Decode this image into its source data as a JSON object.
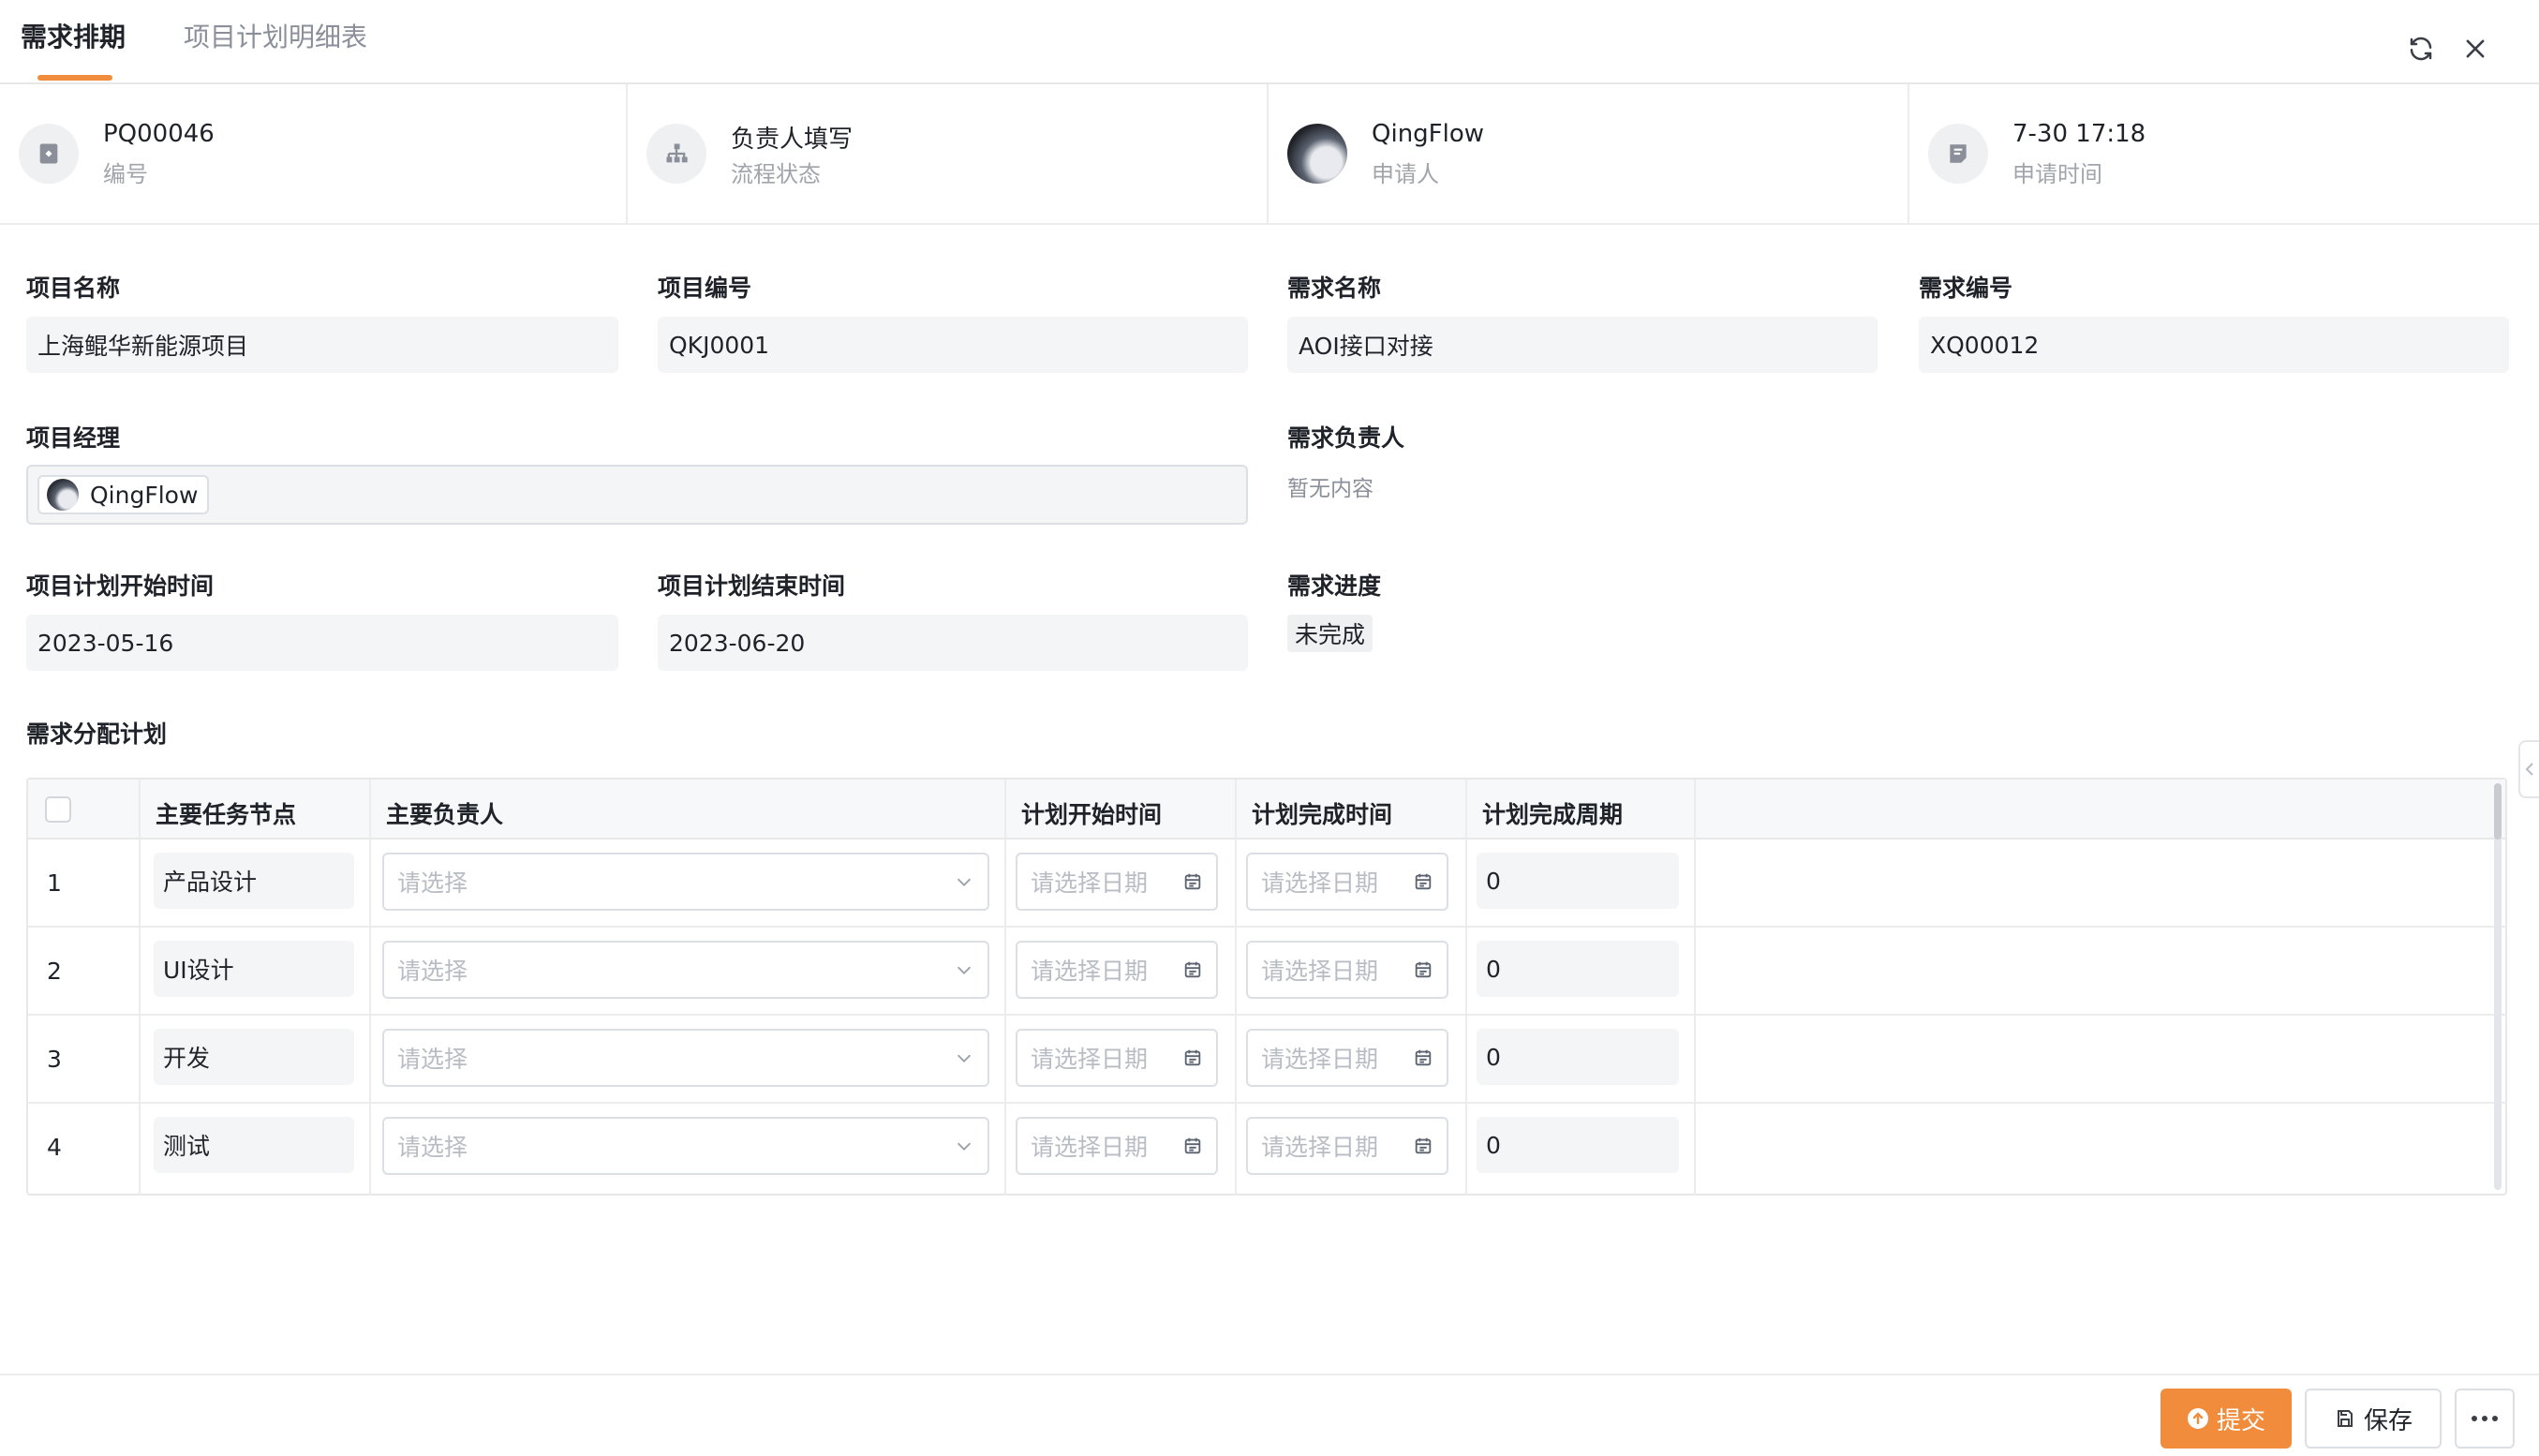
{
  "tabs": [
    {
      "label": "需求排期",
      "active": true
    },
    {
      "label": "项目计划明细表",
      "active": false
    }
  ],
  "header_icons": {
    "refresh": "refresh-icon",
    "close": "close-icon"
  },
  "info": [
    {
      "value": "PQ00046",
      "label": "编号",
      "icon": "tag-icon"
    },
    {
      "value": "负责人填写",
      "label": "流程状态",
      "icon": "org-chart-icon"
    },
    {
      "value": "QingFlow",
      "label": "申请人",
      "icon": "avatar"
    },
    {
      "value": "7-30 17:18",
      "label": "申请时间",
      "icon": "note-icon"
    }
  ],
  "fields": {
    "project_name": {
      "label": "项目名称",
      "value": "上海鲲华新能源项目"
    },
    "project_no": {
      "label": "项目编号",
      "value": "QKJ0001"
    },
    "req_name": {
      "label": "需求名称",
      "value": "AOI接口对接"
    },
    "req_no": {
      "label": "需求编号",
      "value": "XQ00012"
    },
    "pm": {
      "label": "项目经理",
      "value": "QingFlow"
    },
    "req_owner": {
      "label": "需求负责人",
      "value": "暂无内容"
    },
    "plan_start": {
      "label": "项目计划开始时间",
      "value": "2023-05-16"
    },
    "plan_end": {
      "label": "项目计划结束时间",
      "value": "2023-06-20"
    },
    "req_progress": {
      "label": "需求进度",
      "value": "未完成"
    }
  },
  "table": {
    "title": "需求分配计划",
    "columns": [
      "主要任务节点",
      "主要负责人",
      "计划开始时间",
      "计划完成时间",
      "计划完成周期"
    ],
    "select_placeholder": "请选择",
    "date_placeholder": "请选择日期",
    "rows": [
      {
        "no": "1",
        "task": "产品设计",
        "period": "0"
      },
      {
        "no": "2",
        "task": "UI设计",
        "period": "0"
      },
      {
        "no": "3",
        "task": "开发",
        "period": "0"
      },
      {
        "no": "4",
        "task": "测试",
        "period": "0"
      }
    ]
  },
  "footer": {
    "submit": "提交",
    "save": "保存"
  },
  "colors": {
    "accent": "#f08c3c",
    "field_bg": "#f4f5f7",
    "border": "#dcdfe4"
  }
}
